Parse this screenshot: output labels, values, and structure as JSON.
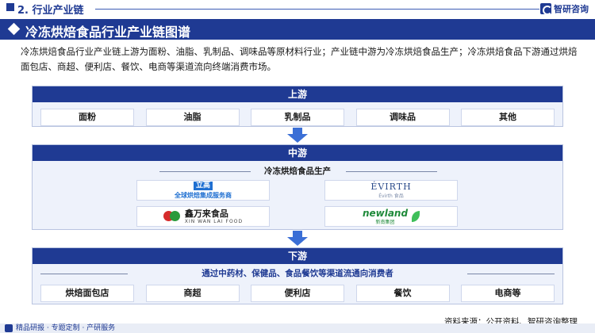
{
  "header": {
    "section": "2. 行业产业链",
    "brand": "智研咨询"
  },
  "title": "冷冻烘焙食品行业产业链图谱",
  "intro": "冷冻烘焙食品行业产业链上游为面粉、油脂、乳制品、调味品等原材料行业；产业链中游为冷冻烘焙食品生产；冷冻烘焙食品下游通过烘焙面包店、商超、便利店、餐饮、电商等渠道流向终端消费市场。",
  "upstream": {
    "label": "上游",
    "items": [
      "面粉",
      "油脂",
      "乳制品",
      "调味品",
      "其他"
    ]
  },
  "midstream": {
    "label": "中游",
    "subtitle": "冷冻烘焙食品生产",
    "companies": [
      {
        "mark": "立高",
        "text": "全球烘焙集成服务商"
      },
      {
        "main": "ÉVIRTH",
        "sub": "Évirth 食品"
      },
      {
        "main": "鑫万来食品",
        "sub": "XIN WAN LAI FOOD"
      },
      {
        "main": "newland",
        "sub": "新南集团"
      }
    ]
  },
  "downstream": {
    "label": "下游",
    "subtitle": "通过中药材、保健品、食品餐饮等渠道流通向消费者",
    "items": [
      "烘焙面包店",
      "商超",
      "便利店",
      "餐饮",
      "电商等"
    ]
  },
  "footer": {
    "source": "资料来源：公开资料、智研咨询整理",
    "slogan": "精品研报 · 专题定制 · 产研服务"
  },
  "colors": {
    "primary": "#1f3a93",
    "arrow": "#3b6fd6",
    "panel": "#eef2fb"
  }
}
